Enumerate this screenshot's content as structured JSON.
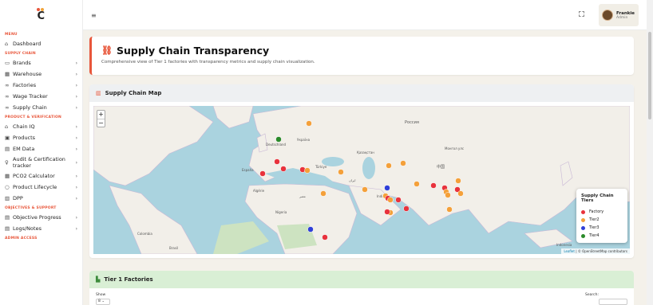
{
  "sidebar": {
    "sections": {
      "menu": "MENU",
      "supply_chain": "SUPPLY CHAIN",
      "product": "PRODUCT & VERIFICATION",
      "objectives": "OBJECTIVES & SUPPORT",
      "admin": "ADMIN ACCESS"
    },
    "items": {
      "dashboard": "Dashboard",
      "brands": "Brands",
      "warehouse": "Warehouse",
      "factories": "Factories",
      "wage_tracker": "Wage Tracker",
      "supply_chain": "Supply Chain",
      "chain_iq": "Chain IQ",
      "products": "Products",
      "em_data": "EM Data",
      "audit": "Audit & Certification tracker",
      "pco2": "PCO2 Calculator",
      "lifecycle": "Product Lifecycle",
      "dpp": "DPP",
      "objective_progress": "Objective Progress",
      "logs": "Logs/Notes"
    }
  },
  "topbar": {
    "user_name": "Frankie",
    "user_role": "Admin"
  },
  "header": {
    "title": "Supply Chain Transparency",
    "subtitle": "Comprehensive view of Tier 1 factories with transparency metrics and supply chain visualization."
  },
  "map": {
    "title": "Supply Chain Map",
    "zoom_in": "+",
    "zoom_out": "−",
    "attribution_leaflet": "Leaflet",
    "attribution_rest": " | © OpenStreetMap contributors",
    "legend": {
      "title": "Supply Chain Tiers",
      "items": [
        {
          "label": "Factory",
          "color": "#e8323c"
        },
        {
          "label": "Tier2",
          "color": "#f4a03a"
        },
        {
          "label": "Tier3",
          "color": "#2f3fd8"
        },
        {
          "label": "Tier4",
          "color": "#2a8a2a"
        }
      ]
    },
    "labels": {
      "deutschland": "Deutschland",
      "espana": "España",
      "mongolia": "Монгол улс",
      "india": "India",
      "algerie": "Algérie",
      "nigeria": "Nigeria",
      "colombia": "Colombia",
      "kazakhstan": "Қазақстан",
      "russia": "Россия",
      "china": "中国",
      "turkiye": "Türkiye",
      "iran": "ایران",
      "egypt": "مصر",
      "ukraine": "Україна",
      "brasil": "Brasil",
      "indonesia": "Indonesia"
    }
  },
  "factories": {
    "title": "Tier 1 Factories",
    "show_label": "Show",
    "page_size": "8",
    "search_label": "Search:"
  }
}
